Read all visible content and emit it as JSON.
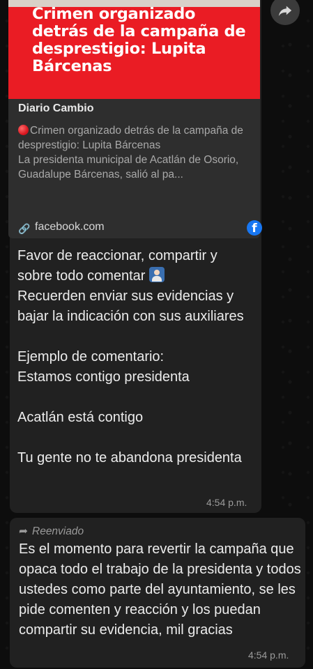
{
  "link_preview": {
    "headline": "Crimen organizado detrás de la campaña de desprestigio: Lupita Bárcenas",
    "source": "Diario Cambio",
    "description_title": "Crimen organizado detrás de la campaña de desprestigio: Lupita Bárcenas",
    "description_body": "La presidenta municipal de Acatlán de Osorio, Guadalupe Bárcenas, salió al pa...",
    "domain": "facebook.com",
    "accent_color": "#ea1c24"
  },
  "message1": {
    "line1": "Favor de reaccionar, compartir y sobre todo comentar",
    "line2": "Recuerden enviar sus evidencias y bajar la indicación con sus auxiliares",
    "line3": "Ejemplo de comentario:",
    "line4": "Estamos contigo presidenta",
    "line5": "Acatlán está contigo",
    "line6": "Tu gente no te abandona presidenta",
    "time": "4:54 p.m.",
    "emoji_icon": "person-raising-hand-icon"
  },
  "message2": {
    "forwarded_label": "Reenviado",
    "text": "Es el momento para revertir la campaña que opaca todo el trabajo de la presidenta y todos ustedes como parte del ayuntamiento, se les pide comenten y reacción y los puedan compartir su evidencia, mil gracias",
    "time": "4:54 p.m."
  },
  "icons": {
    "share": "share-forward-icon",
    "link": "link-icon",
    "facebook": "facebook-icon",
    "forwarded": "forwarded-arrow-icon"
  }
}
